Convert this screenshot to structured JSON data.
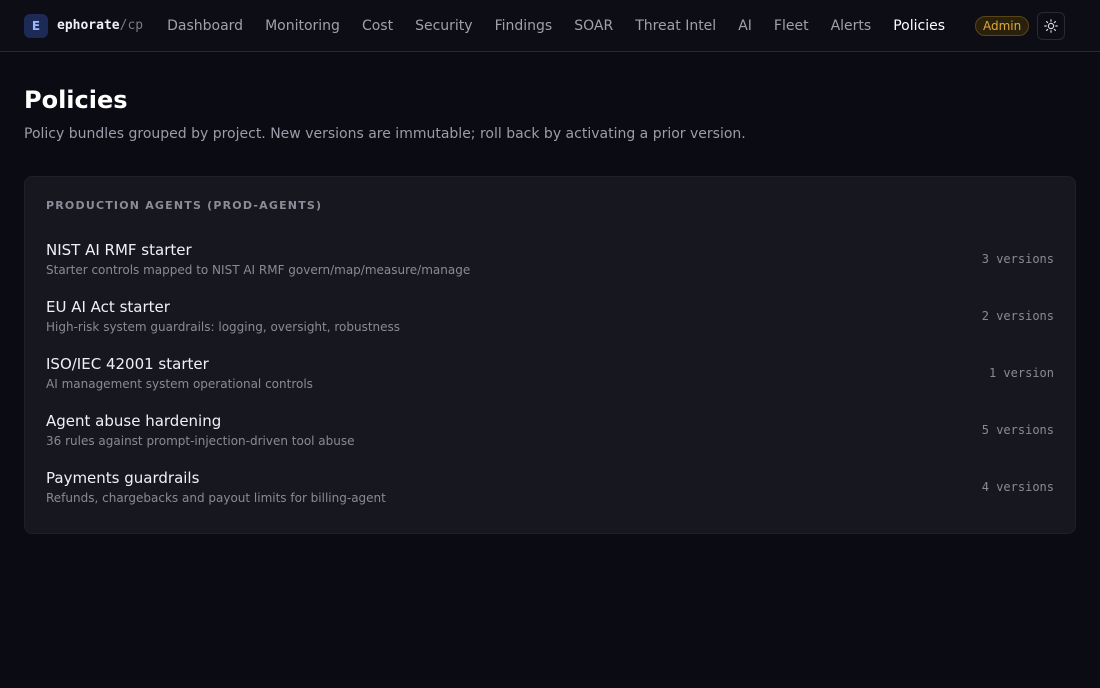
{
  "brand": {
    "logo_letter": "E",
    "name": "ephorate",
    "separator": "/",
    "suffix": "cp"
  },
  "nav": {
    "items": [
      {
        "label": "Dashboard"
      },
      {
        "label": "Monitoring"
      },
      {
        "label": "Cost"
      },
      {
        "label": "Security"
      },
      {
        "label": "Findings"
      },
      {
        "label": "SOAR"
      },
      {
        "label": "Threat Intel"
      },
      {
        "label": "AI"
      },
      {
        "label": "Fleet"
      },
      {
        "label": "Alerts"
      },
      {
        "label": "Policies",
        "active": true
      }
    ],
    "role_badge": "Admin",
    "theme_icon": "sun-icon"
  },
  "page": {
    "title": "Policies",
    "subtitle": "Policy bundles grouped by project. New versions are immutable; roll back by activating a prior version."
  },
  "project": {
    "heading": "PRODUCTION AGENTS (PROD-AGENTS)",
    "policies": [
      {
        "name": "NIST AI RMF starter",
        "description": "Starter controls mapped to NIST AI RMF govern/map/measure/manage",
        "versions": "3 versions"
      },
      {
        "name": "EU AI Act starter",
        "description": "High-risk system guardrails: logging, oversight, robustness",
        "versions": "2 versions"
      },
      {
        "name": "ISO/IEC 42001 starter",
        "description": "AI management system operational controls",
        "versions": "1 version"
      },
      {
        "name": "Agent abuse hardening",
        "description": "36 rules against prompt-injection-driven tool abuse",
        "versions": "5 versions"
      },
      {
        "name": "Payments guardrails",
        "description": "Refunds, chargebacks and payout limits for billing-agent",
        "versions": "4 versions"
      }
    ]
  },
  "colors": {
    "background": "#0b0b13",
    "card": "#17171f",
    "accent_badge": "#e0a93a",
    "logo": "#1d2a55"
  }
}
